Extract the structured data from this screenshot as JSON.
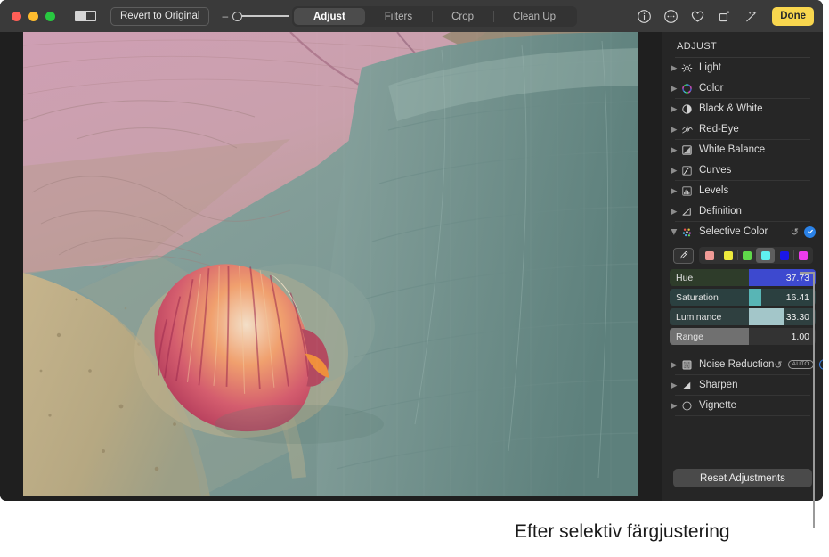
{
  "window": {
    "toolbar": {
      "traffic_lights": [
        "close",
        "minimize",
        "zoom"
      ],
      "split_view_label": "split-view-toggle",
      "revert_label": "Revert to Original",
      "zoom_minus": "–",
      "zoom_plus": "+",
      "tabs": [
        {
          "label": "Adjust",
          "active": true
        },
        {
          "label": "Filters",
          "active": false
        },
        {
          "label": "Crop",
          "active": false
        },
        {
          "label": "Clean Up",
          "active": false
        }
      ],
      "icons": [
        "info-icon",
        "more-options-icon",
        "favorite-heart-icon",
        "rotate-icon",
        "enhance-wand-icon"
      ],
      "done_label": "Done"
    }
  },
  "sidebar": {
    "title": "ADJUST",
    "items": [
      {
        "label": "Light",
        "icon": "light-icon",
        "expanded": false
      },
      {
        "label": "Color",
        "icon": "color-wheel-icon",
        "expanded": false
      },
      {
        "label": "Black & White",
        "icon": "black-white-icon",
        "expanded": false
      },
      {
        "label": "Red-Eye",
        "icon": "red-eye-icon",
        "expanded": false
      },
      {
        "label": "White Balance",
        "icon": "white-balance-icon",
        "expanded": false
      },
      {
        "label": "Curves",
        "icon": "curves-icon",
        "expanded": false
      },
      {
        "label": "Levels",
        "icon": "levels-icon",
        "expanded": false
      },
      {
        "label": "Definition",
        "icon": "definition-icon",
        "expanded": false
      },
      {
        "label": "Selective Color",
        "icon": "selective-color-icon",
        "expanded": true
      }
    ],
    "after_items": [
      {
        "label": "Noise Reduction",
        "icon": "noise-reduction-icon",
        "auto_badge": "AUTO",
        "has_reset": true,
        "has_toggle": true
      },
      {
        "label": "Sharpen",
        "icon": "sharpen-icon"
      },
      {
        "label": "Vignette",
        "icon": "vignette-icon"
      }
    ],
    "selective_color": {
      "eyedropper": "eyedropper-icon",
      "swatches": [
        {
          "name": "red",
          "color": "#f09a96",
          "selected": false
        },
        {
          "name": "yellow",
          "color": "#eeea3c",
          "selected": false
        },
        {
          "name": "green",
          "color": "#5fd94a",
          "selected": false
        },
        {
          "name": "cyan",
          "color": "#5ff0f0",
          "selected": true
        },
        {
          "name": "blue",
          "color": "#1a17e8",
          "selected": false
        },
        {
          "name": "magenta",
          "color": "#ee3cee",
          "selected": false
        }
      ],
      "sliders": [
        {
          "name": "Hue",
          "value": "37.73",
          "fill_start_pct": 54.5,
          "fill_end_pct": 100,
          "track_color": "#2e3c2a",
          "fill_color": "#3d49cf"
        },
        {
          "name": "Saturation",
          "value": "16.41",
          "fill_start_pct": 54.5,
          "fill_end_pct": 63,
          "track_color": "#2b4040",
          "fill_color": "#58b5b5"
        },
        {
          "name": "Luminance",
          "value": "33.30",
          "fill_start_pct": 54.5,
          "fill_end_pct": 78,
          "track_color": "#2f4040",
          "fill_color": "#a3c6c9"
        },
        {
          "name": "Range",
          "value": "1.00",
          "fill_start_pct": 0,
          "fill_end_pct": 54.5,
          "track_color": "#333333",
          "fill_color": "#707070"
        }
      ],
      "reset_tooltip": "reset-selective-color",
      "enabled": true
    },
    "reset_button": "Reset Adjustments"
  },
  "caption": "Efter selektiv färgjustering",
  "colors": {
    "accent_done": "#f8d64e",
    "accent_toggle": "#2a82e8",
    "toolbar_bg": "#3a3a3a",
    "sidebar_bg": "#262626"
  }
}
